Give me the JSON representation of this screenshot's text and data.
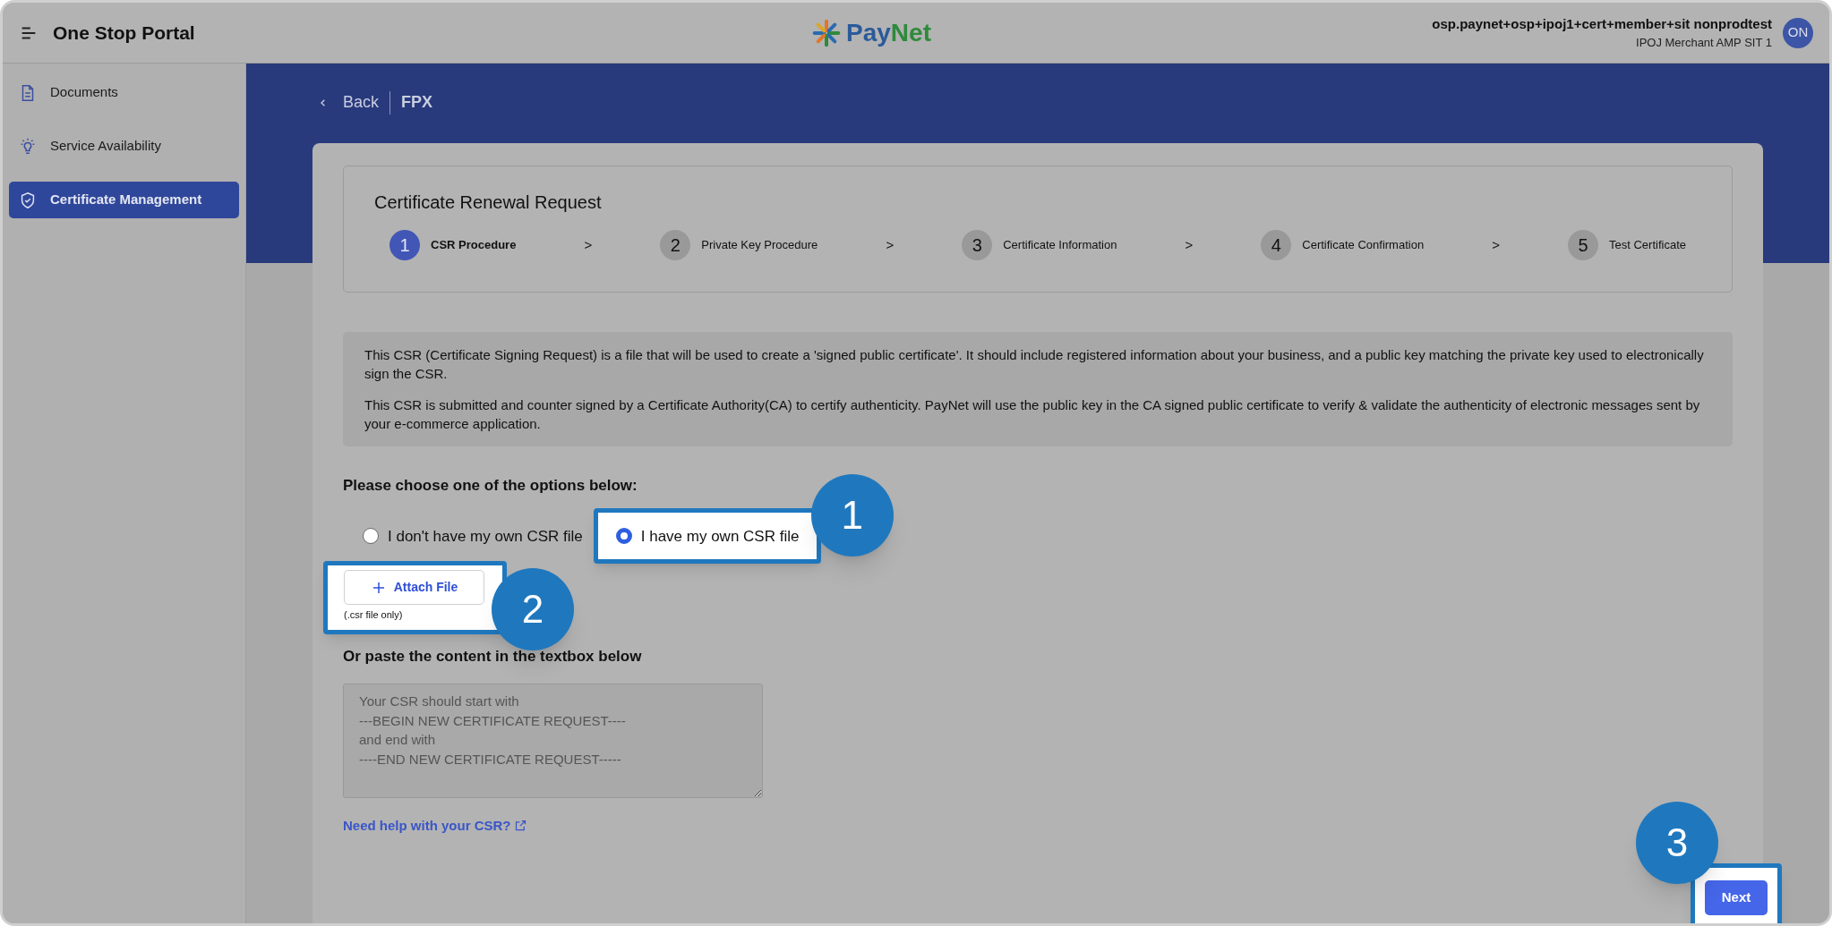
{
  "header": {
    "title": "One Stop Portal",
    "logo": {
      "part_1": "Pay",
      "part_2": "Net"
    },
    "user": {
      "email": "osp.paynet+osp+ipoj1+cert+member+sit nonprodtest",
      "account": "IPOJ Merchant AMP SIT 1",
      "initials": "ON"
    }
  },
  "sidebar": {
    "items": [
      {
        "label": "Documents",
        "kind": "document",
        "selected": false
      },
      {
        "label": "Service Availability",
        "kind": "bulb",
        "selected": false
      },
      {
        "label": "Certificate Management",
        "kind": "shield",
        "selected": true
      }
    ]
  },
  "breadcrumb": {
    "back": "Back",
    "current": "FPX"
  },
  "stepper": {
    "title": "Certificate Renewal Request",
    "steps": [
      {
        "number": "1",
        "label": "CSR Procedure",
        "selected": true
      },
      {
        "number": "2",
        "label": "Private Key Procedure",
        "selected": false
      },
      {
        "number": "3",
        "label": "Certificate Information",
        "selected": false
      },
      {
        "number": "4",
        "label": "Certificate Confirmation",
        "selected": false
      },
      {
        "number": "5",
        "label": "Test Certificate",
        "selected": false
      }
    ],
    "separator": ">"
  },
  "info": [
    "This CSR (Certificate Signing Request) is a file that will be used to create a 'signed public certificate'. It should include registered information about your business, and a public key matching the private key used to electronically sign the CSR.",
    "This CSR is submitted and counter signed by a Certificate Authority(CA) to certify authenticity. PayNet will use the public key in the CA signed public certificate to verify & validate the authenticity of electronic messages sent by your e-commerce application."
  ],
  "options": {
    "heading": "Please choose one of the options below:",
    "items": [
      {
        "label": "I don't have my own CSR file",
        "selected": false
      },
      {
        "label": "I have my own CSR file",
        "selected": true,
        "callout": "1"
      }
    ]
  },
  "attach": {
    "label": "Attach File",
    "hint": "(.csr file only)",
    "callout": "2"
  },
  "paste": {
    "heading": "Or paste the content in the textbox below",
    "placeholder": "Your CSR should start with\n---BEGIN NEW CERTIFICATE REQUEST----\nand end with\n----END NEW CERTIFICATE REQUEST-----"
  },
  "help_link": "Need help with your CSR?",
  "next": {
    "label": "Next",
    "callout": "3"
  }
}
